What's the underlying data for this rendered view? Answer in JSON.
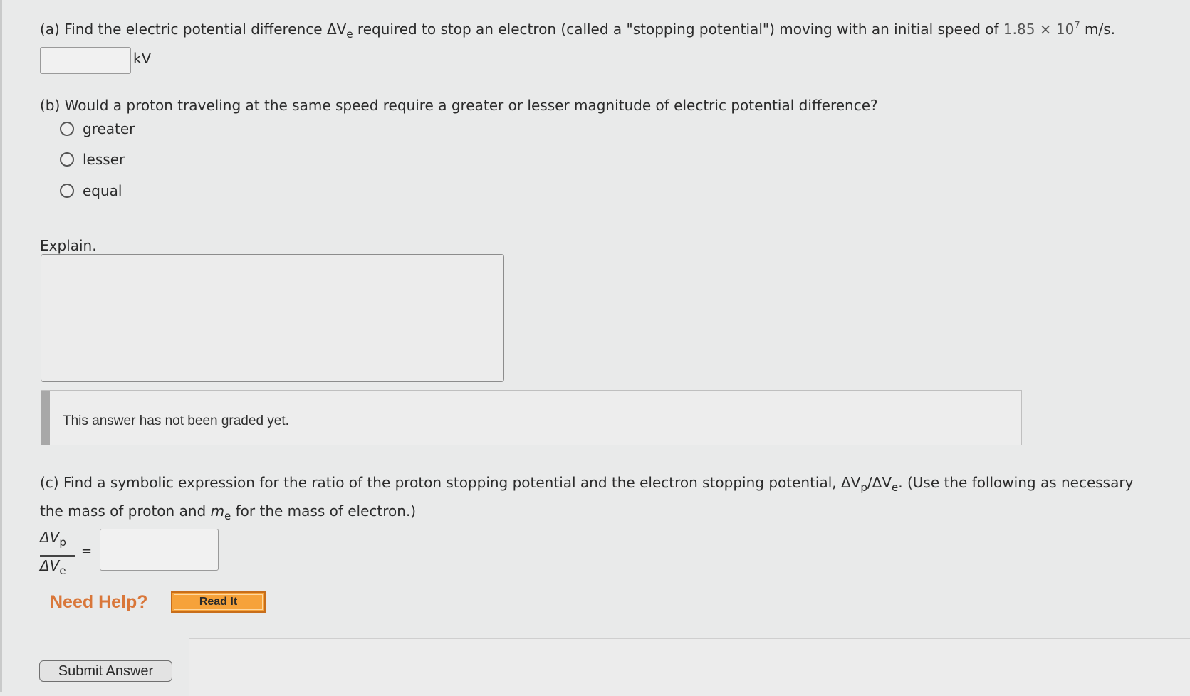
{
  "part_a": {
    "prefix": "(a) Find the electric potential difference ΔV",
    "sub": "e",
    "middle": " required to stop an electron (called a \"stopping potential\") moving with an initial speed of ",
    "speed_mantissa": "1.85 × 10",
    "speed_exponent": "7",
    "suffix": " m/s.",
    "unit": "kV",
    "answer_value": ""
  },
  "part_b": {
    "question": "(b) Would a proton traveling at the same speed require a greater or lesser magnitude of electric potential difference?",
    "options": [
      "greater",
      "lesser",
      "equal"
    ],
    "explain_label": "Explain.",
    "explain_value": ""
  },
  "grading": {
    "status": "This answer has not been graded yet."
  },
  "part_c": {
    "line1_prefix": "(c) Find a symbolic expression for the ratio of the proton stopping potential and the electron stopping potential, ΔV",
    "line1_sub_p": "p",
    "line1_slash": "/ΔV",
    "line1_sub_e": "e",
    "line1_suffix": ". (Use the following as necessary",
    "line2_prefix": "the mass of proton and ",
    "m_symbol": "m",
    "m_sub": "e",
    "line2_suffix": " for the mass of electron.)",
    "frac_num": "ΔV",
    "frac_num_sub": "p",
    "frac_den": "ΔV",
    "frac_den_sub": "e",
    "equals": "=",
    "answer_value": ""
  },
  "help": {
    "label": "Need Help?",
    "read_it": "Read It"
  },
  "submit_label": "Submit Answer"
}
